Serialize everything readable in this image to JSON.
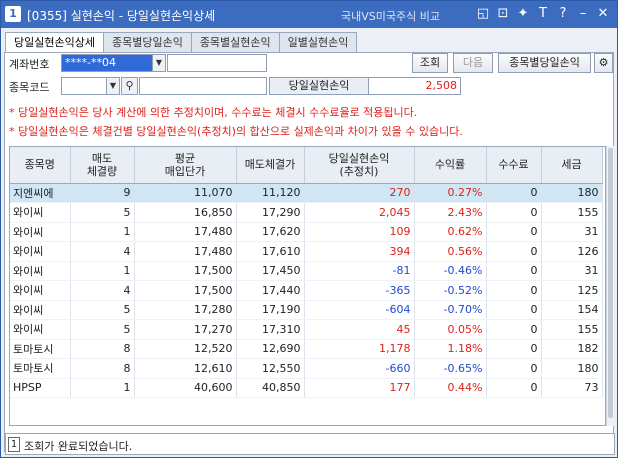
{
  "window": {
    "screen_no": "1",
    "title": "[0355] 실현손익 - 당일실현손익상세",
    "subtitle": "국내VS미국주식 비교",
    "icons": [
      "window-icon",
      "link-icon",
      "pin-icon",
      "text-icon",
      "help-icon",
      "minimize-icon",
      "close-icon"
    ]
  },
  "tabs": [
    {
      "label": "당일실현손익상세",
      "active": true
    },
    {
      "label": "종목별당일손익",
      "active": false
    },
    {
      "label": "종목별실현손익",
      "active": false
    },
    {
      "label": "일별실현손익",
      "active": false
    }
  ],
  "form": {
    "account_label": "계좌번호",
    "account_value": "****-**04",
    "account_name": "",
    "code_label": "종목코드",
    "code_value": "",
    "code_name": "",
    "pnl_label": "당일실현손익",
    "pnl_value": "2,508",
    "query_label": "조회",
    "next_label": "다음",
    "by_stock_label": "종목별당일손익"
  },
  "notes": [
    "* 당일실현손익은 당사 계산에 의한 추정치이며, 수수료는 체결시 수수료율로 적용됩니다.",
    "* 당일실현손익은 체결건별 당일실현손익(추정치)의 합산으로 실제손익과 차이가 있을 수 있습니다."
  ],
  "table": {
    "headers": [
      {
        "l1": "종목명",
        "l2": ""
      },
      {
        "l1": "매도",
        "l2": "체결량"
      },
      {
        "l1": "평균",
        "l2": "매입단가"
      },
      {
        "l1": "매도체결가",
        "l2": ""
      },
      {
        "l1": "당일실현손익",
        "l2": "(추정치)"
      },
      {
        "l1": "수익률",
        "l2": ""
      },
      {
        "l1": "수수료",
        "l2": ""
      },
      {
        "l1": "세금",
        "l2": ""
      }
    ],
    "rows": [
      {
        "name": "지엔씨에",
        "qty": "9",
        "avg": "11,070",
        "sell": "11,120",
        "pnl": "270",
        "rate": "0.27%",
        "fee": "0",
        "tax": "180",
        "sign": "pos",
        "selected": true
      },
      {
        "name": "와이씨",
        "qty": "5",
        "avg": "16,850",
        "sell": "17,290",
        "pnl": "2,045",
        "rate": "2.43%",
        "fee": "0",
        "tax": "155",
        "sign": "pos",
        "selected": false
      },
      {
        "name": "와이씨",
        "qty": "1",
        "avg": "17,480",
        "sell": "17,620",
        "pnl": "109",
        "rate": "0.62%",
        "fee": "0",
        "tax": "31",
        "sign": "pos",
        "selected": false
      },
      {
        "name": "와이씨",
        "qty": "4",
        "avg": "17,480",
        "sell": "17,610",
        "pnl": "394",
        "rate": "0.56%",
        "fee": "0",
        "tax": "126",
        "sign": "pos",
        "selected": false
      },
      {
        "name": "와이씨",
        "qty": "1",
        "avg": "17,500",
        "sell": "17,450",
        "pnl": "-81",
        "rate": "-0.46%",
        "fee": "0",
        "tax": "31",
        "sign": "neg",
        "selected": false
      },
      {
        "name": "와이씨",
        "qty": "4",
        "avg": "17,500",
        "sell": "17,440",
        "pnl": "-365",
        "rate": "-0.52%",
        "fee": "0",
        "tax": "125",
        "sign": "neg",
        "selected": false
      },
      {
        "name": "와이씨",
        "qty": "5",
        "avg": "17,280",
        "sell": "17,190",
        "pnl": "-604",
        "rate": "-0.70%",
        "fee": "0",
        "tax": "154",
        "sign": "neg",
        "selected": false
      },
      {
        "name": "와이씨",
        "qty": "5",
        "avg": "17,270",
        "sell": "17,310",
        "pnl": "45",
        "rate": "0.05%",
        "fee": "0",
        "tax": "155",
        "sign": "pos",
        "selected": false
      },
      {
        "name": "토마토시",
        "qty": "8",
        "avg": "12,520",
        "sell": "12,690",
        "pnl": "1,178",
        "rate": "1.18%",
        "fee": "0",
        "tax": "182",
        "sign": "pos",
        "selected": false
      },
      {
        "name": "토마토시",
        "qty": "8",
        "avg": "12,610",
        "sell": "12,550",
        "pnl": "-660",
        "rate": "-0.65%",
        "fee": "0",
        "tax": "180",
        "sign": "neg",
        "selected": false
      },
      {
        "name": "HPSP",
        "qty": "1",
        "avg": "40,600",
        "sell": "40,850",
        "pnl": "177",
        "rate": "0.44%",
        "fee": "0",
        "tax": "73",
        "sign": "pos",
        "selected": false
      }
    ]
  },
  "status": {
    "num": "1",
    "message": "조회가 완료되었습니다."
  },
  "colors": {
    "title_bar": "#3c6cc0",
    "positive": "#e0201a",
    "negative": "#1f4ad0",
    "selected_row": "#cfe6f5"
  }
}
